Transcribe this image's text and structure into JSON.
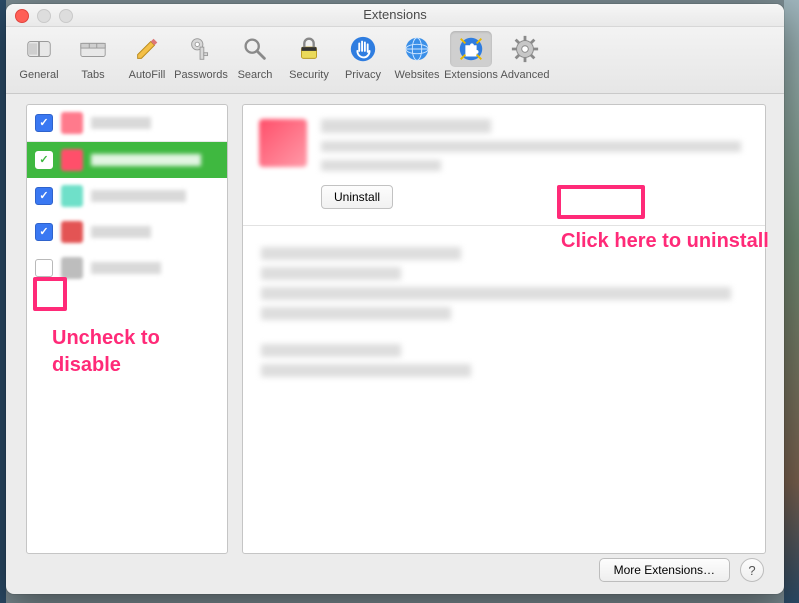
{
  "window": {
    "title": "Extensions"
  },
  "toolbar": {
    "items": [
      {
        "id": "general",
        "label": "General"
      },
      {
        "id": "tabs",
        "label": "Tabs"
      },
      {
        "id": "autofill",
        "label": "AutoFill"
      },
      {
        "id": "passwords",
        "label": "Passwords"
      },
      {
        "id": "search",
        "label": "Search"
      },
      {
        "id": "security",
        "label": "Security"
      },
      {
        "id": "privacy",
        "label": "Privacy"
      },
      {
        "id": "websites",
        "label": "Websites"
      },
      {
        "id": "extensions",
        "label": "Extensions"
      },
      {
        "id": "advanced",
        "label": "Advanced"
      }
    ],
    "selected": "extensions"
  },
  "sidebar": {
    "items": [
      {
        "checked": true,
        "selected": false,
        "icon_color": "#ff7a8c"
      },
      {
        "checked": true,
        "selected": true,
        "icon_color": "#ff4f6a"
      },
      {
        "checked": true,
        "selected": false,
        "icon_color": "#6fe0c9"
      },
      {
        "checked": true,
        "selected": false,
        "icon_color": "#e35454"
      },
      {
        "checked": false,
        "selected": false,
        "icon_color": "#bdbdbd"
      }
    ]
  },
  "detail": {
    "uninstall_label": "Uninstall"
  },
  "footer": {
    "more_label": "More Extensions…",
    "help_label": "?"
  },
  "annotations": {
    "uncheck": "Uncheck to disable",
    "click_uninstall": "Click here to uninstall"
  }
}
